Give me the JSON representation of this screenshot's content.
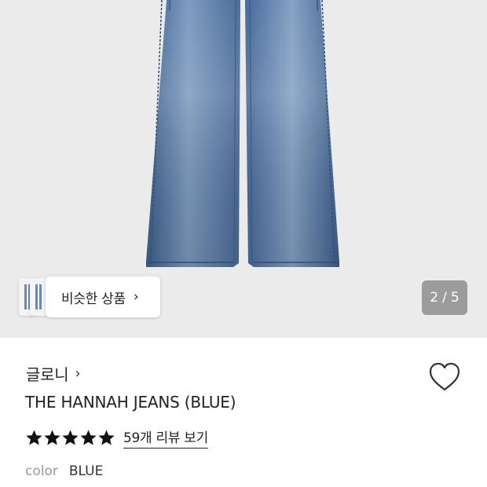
{
  "gallery": {
    "similar_label": "비슷한 상품",
    "similar_chevron": "›",
    "page_current": "2",
    "page_separator": "/",
    "page_total": "5"
  },
  "product": {
    "brand": "글로니",
    "brand_chevron": "›",
    "title": "THE HANNAH JEANS (BLUE)",
    "rating": 5,
    "review_link": "59개 리뷰 보기",
    "color_label": "color",
    "color_value": "BLUE"
  },
  "colors": {
    "hero_bg": "#ebebeb",
    "denim": "#5a7ba6",
    "counter_bg": "#9c9c9c",
    "star": "#111111"
  },
  "icons": {
    "wishlist": "heart-outline-icon",
    "rating": "star-filled-icon"
  }
}
